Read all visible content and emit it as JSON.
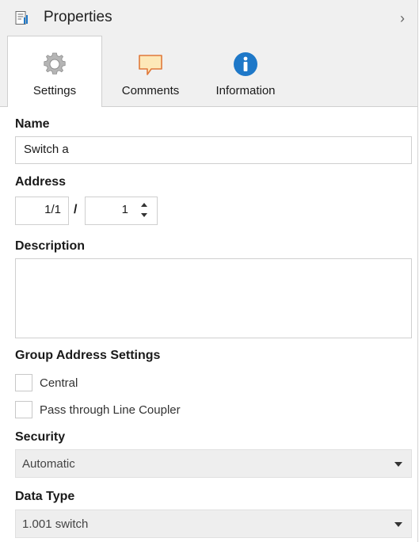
{
  "header": {
    "title": "Properties",
    "collapse_icon": "chevron-right-icon"
  },
  "tabs": [
    {
      "label": "Settings",
      "icon": "gear-icon",
      "active": true
    },
    {
      "label": "Comments",
      "icon": "comment-icon",
      "active": false
    },
    {
      "label": "Information",
      "icon": "info-icon",
      "active": false
    }
  ],
  "name": {
    "label": "Name",
    "value": "Switch a"
  },
  "address": {
    "label": "Address",
    "prefix": "1/1",
    "separator": "/",
    "value": "1"
  },
  "description": {
    "label": "Description",
    "value": ""
  },
  "group_settings": {
    "label": "Group Address Settings",
    "options": [
      {
        "label": "Central",
        "checked": false
      },
      {
        "label": "Pass through Line Coupler",
        "checked": false
      }
    ]
  },
  "security": {
    "label": "Security",
    "value": "Automatic"
  },
  "data_type": {
    "label": "Data Type",
    "value": "1.001 switch"
  },
  "colors": {
    "accent": "#1e78c8",
    "comment_fill": "#fde8b8",
    "comment_stroke": "#e0793a"
  }
}
